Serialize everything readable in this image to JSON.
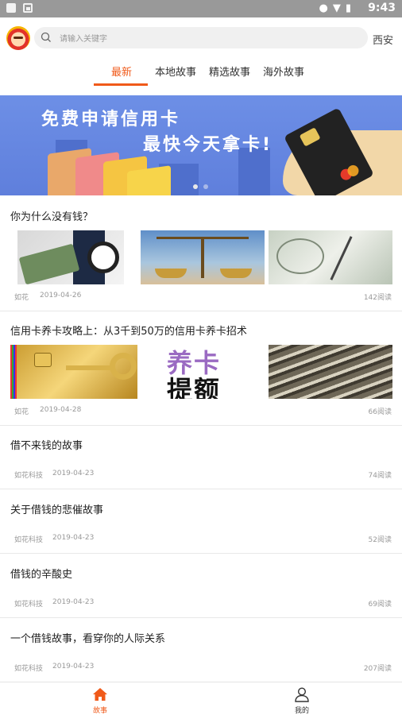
{
  "status_bar": {
    "time": "9:43"
  },
  "header": {
    "search_placeholder": "请输入关键字",
    "city": "西安"
  },
  "tabs": [
    {
      "label": "最新",
      "active": true
    },
    {
      "label": "本地故事",
      "active": false
    },
    {
      "label": "精选故事",
      "active": false
    },
    {
      "label": "海外故事",
      "active": false
    }
  ],
  "banner": {
    "line1": "免费申请信用卡",
    "line2": "最快今天拿卡!",
    "slide_count": 2,
    "active_slide": 2
  },
  "articles": [
    {
      "title": "你为什么没有钱？",
      "author": "如花",
      "date": "2019-04-26",
      "reads": "142阅读",
      "images": [
        "money-clock-image",
        "scale-image",
        "dollars-compass-image"
      ]
    },
    {
      "title": "信用卡养卡攻略上：从3千到50万的信用卡养卡招术",
      "author": "如花",
      "date": "2019-04-28",
      "reads": "66阅读",
      "images": [
        "gold-card-key-image",
        "text-card-image",
        "card-stack-image"
      ],
      "image_text": [
        "养卡",
        "提额"
      ]
    },
    {
      "title": "借不来钱的故事",
      "author": "如花科技",
      "date": "2019-04-23",
      "reads": "74阅读"
    },
    {
      "title": "关于借钱的悲催故事",
      "author": "如花科技",
      "date": "2019-04-23",
      "reads": "52阅读"
    },
    {
      "title": "借钱的辛酸史",
      "author": "如花科技",
      "date": "2019-04-23",
      "reads": "69阅读"
    },
    {
      "title": "一个借钱故事，看穿你的人际关系",
      "author": "如花科技",
      "date": "2019-04-23",
      "reads": "207阅读"
    }
  ],
  "bottom_nav": [
    {
      "label": "故事",
      "icon": "home-icon",
      "active": true
    },
    {
      "label": "我的",
      "icon": "person-icon",
      "active": false
    }
  ],
  "colors": {
    "accent": "#f05a1a",
    "status_bar": "#999999",
    "banner": "#6d8fe6"
  }
}
